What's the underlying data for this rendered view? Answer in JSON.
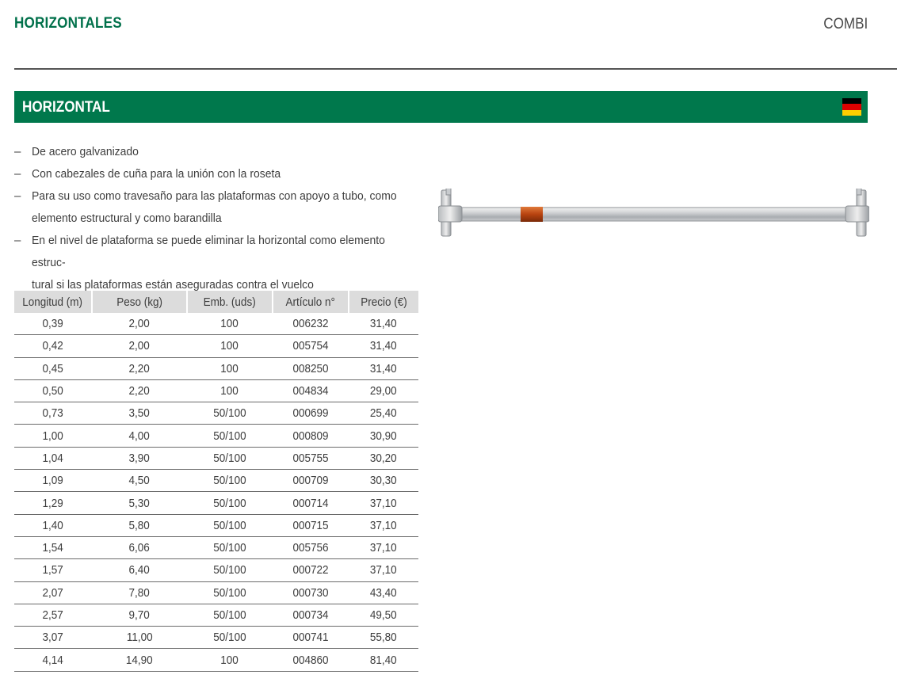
{
  "header": {
    "section_title": "HORIZONTALES",
    "brand": "COMBI"
  },
  "product": {
    "title": "HORIZONTAL",
    "flag_colors": [
      "#000000",
      "#dd0000",
      "#ffce00"
    ],
    "accent_color": "#00784c",
    "features": [
      "De acero galvanizado",
      "Con cabezales de cuña para la unión con la roseta",
      "Para su uso como travesaño para las plataformas con apoyo a tubo, como",
      "elemento estructural y como barandilla",
      "En el nivel de plataforma se puede eliminar la horizontal como elemento estruc-",
      "tural si las plataformas están aseguradas contra el vuelco"
    ],
    "image_icon": "horizontal-ledger-tube"
  },
  "table": {
    "headers": [
      "Longitud (m)",
      "Peso (kg)",
      "Emb. (uds)",
      "Artículo n°",
      "Precio (€)"
    ],
    "rows": [
      [
        "0,39",
        "2,00",
        "100",
        "006232",
        "31,40"
      ],
      [
        "0,42",
        "2,00",
        "100",
        "005754",
        "31,40"
      ],
      [
        "0,45",
        "2,20",
        "100",
        "008250",
        "31,40"
      ],
      [
        "0,50",
        "2,20",
        "100",
        "004834",
        "29,00"
      ],
      [
        "0,73",
        "3,50",
        "50/100",
        "000699",
        "25,40"
      ],
      [
        "1,00",
        "4,00",
        "50/100",
        "000809",
        "30,90"
      ],
      [
        "1,04",
        "3,90",
        "50/100",
        "005755",
        "30,20"
      ],
      [
        "1,09",
        "4,50",
        "50/100",
        "000709",
        "30,30"
      ],
      [
        "1,29",
        "5,30",
        "50/100",
        "000714",
        "37,10"
      ],
      [
        "1,40",
        "5,80",
        "50/100",
        "000715",
        "37,10"
      ],
      [
        "1,54",
        "6,06",
        "50/100",
        "005756",
        "37,10"
      ],
      [
        "1,57",
        "6,40",
        "50/100",
        "000722",
        "37,10"
      ],
      [
        "2,07",
        "7,80",
        "50/100",
        "000730",
        "43,40"
      ],
      [
        "2,57",
        "9,70",
        "50/100",
        "000734",
        "49,50"
      ],
      [
        "3,07",
        "11,00",
        "50/100",
        "000741",
        "55,80"
      ],
      [
        "4,14",
        "14,90",
        "100",
        "004860",
        "81,40"
      ]
    ]
  }
}
